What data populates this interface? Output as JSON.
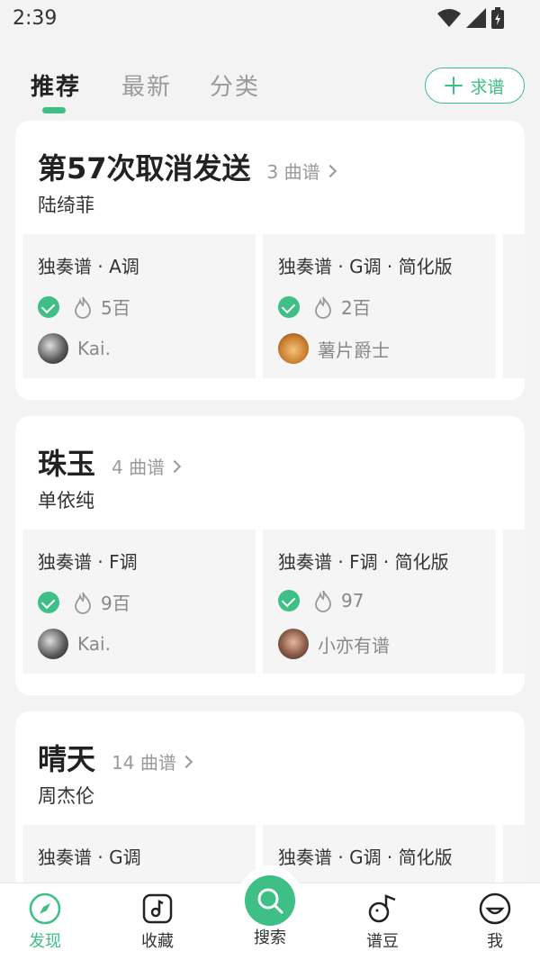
{
  "status": {
    "time": "2:39"
  },
  "tabs": [
    {
      "label": "推荐"
    },
    {
      "label": "最新"
    },
    {
      "label": "分类"
    }
  ],
  "request_button": {
    "label": "求谱"
  },
  "songs": [
    {
      "title": "第57次取消发送",
      "count": "3 曲谱",
      "artist": "陆绮菲",
      "scores": [
        {
          "name": "独奏谱 · A调",
          "heat": "5百",
          "author": "Kai."
        },
        {
          "name": "独奏谱 · G调 · 简化版",
          "heat": "2百",
          "author": "薯片爵士"
        }
      ]
    },
    {
      "title": "珠玉",
      "count": "4 曲谱",
      "artist": "单依纯",
      "scores": [
        {
          "name": "独奏谱 · F调",
          "heat": "9百",
          "author": "Kai."
        },
        {
          "name": "独奏谱 · F调 · 简化版",
          "heat": "97",
          "author": "小亦有谱"
        }
      ]
    },
    {
      "title": "晴天",
      "count": "14 曲谱",
      "artist": "周杰伦",
      "scores": [
        {
          "name": "独奏谱 · G调"
        },
        {
          "name": "独奏谱 · G调 · 简化版"
        }
      ]
    }
  ],
  "bottom_nav": [
    {
      "label": "发现",
      "icon": "compass-icon"
    },
    {
      "label": "收藏",
      "icon": "music-note-icon"
    },
    {
      "label": "搜索",
      "icon": "search-icon"
    },
    {
      "label": "谱豆",
      "icon": "bean-icon"
    },
    {
      "label": "我",
      "icon": "smile-icon"
    }
  ],
  "colors": {
    "accent": "#3dbf86",
    "background": "#f3f3f3"
  }
}
